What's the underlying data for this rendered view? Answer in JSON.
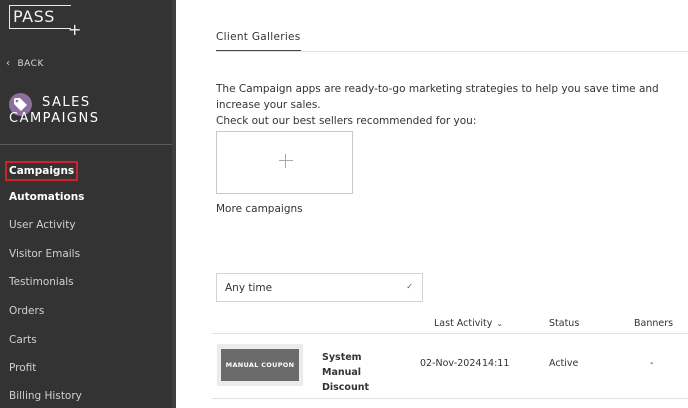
{
  "sidebar": {
    "logo_text": "PASS",
    "logo_plus": "+",
    "back_label": "BACK",
    "title_line1": "SALES",
    "title_line2": "CAMPAIGNS",
    "items": [
      {
        "label": "Campaigns"
      },
      {
        "label": "Automations"
      },
      {
        "label": "User Activity"
      },
      {
        "label": "Visitor Emails"
      },
      {
        "label": "Testimonials"
      },
      {
        "label": "Orders"
      },
      {
        "label": "Carts"
      },
      {
        "label": "Profit"
      },
      {
        "label": "Billing History"
      }
    ]
  },
  "main": {
    "tab_label": "Client Galleries",
    "intro_line1": "The Campaign apps are ready-to-go marketing strategies to help you save time and increase your sales.",
    "intro_line2": "Check out our best sellers recommended for you:",
    "more_campaigns": "More campaigns",
    "time_filter": "Any time",
    "table": {
      "headers": {
        "last_activity": "Last Activity",
        "status": "Status",
        "banners": "Banners"
      },
      "rows": [
        {
          "thumb_text": "MANUAL COUPON",
          "name": "System Manual Discount",
          "date": "02-Nov-2024",
          "time": "14:11",
          "status": "Active",
          "banners": "-"
        }
      ]
    }
  },
  "colors": {
    "sidebar_bg": "#333333",
    "active_highlight": "#d0202a",
    "brand_icon": "#8d6e9e"
  }
}
